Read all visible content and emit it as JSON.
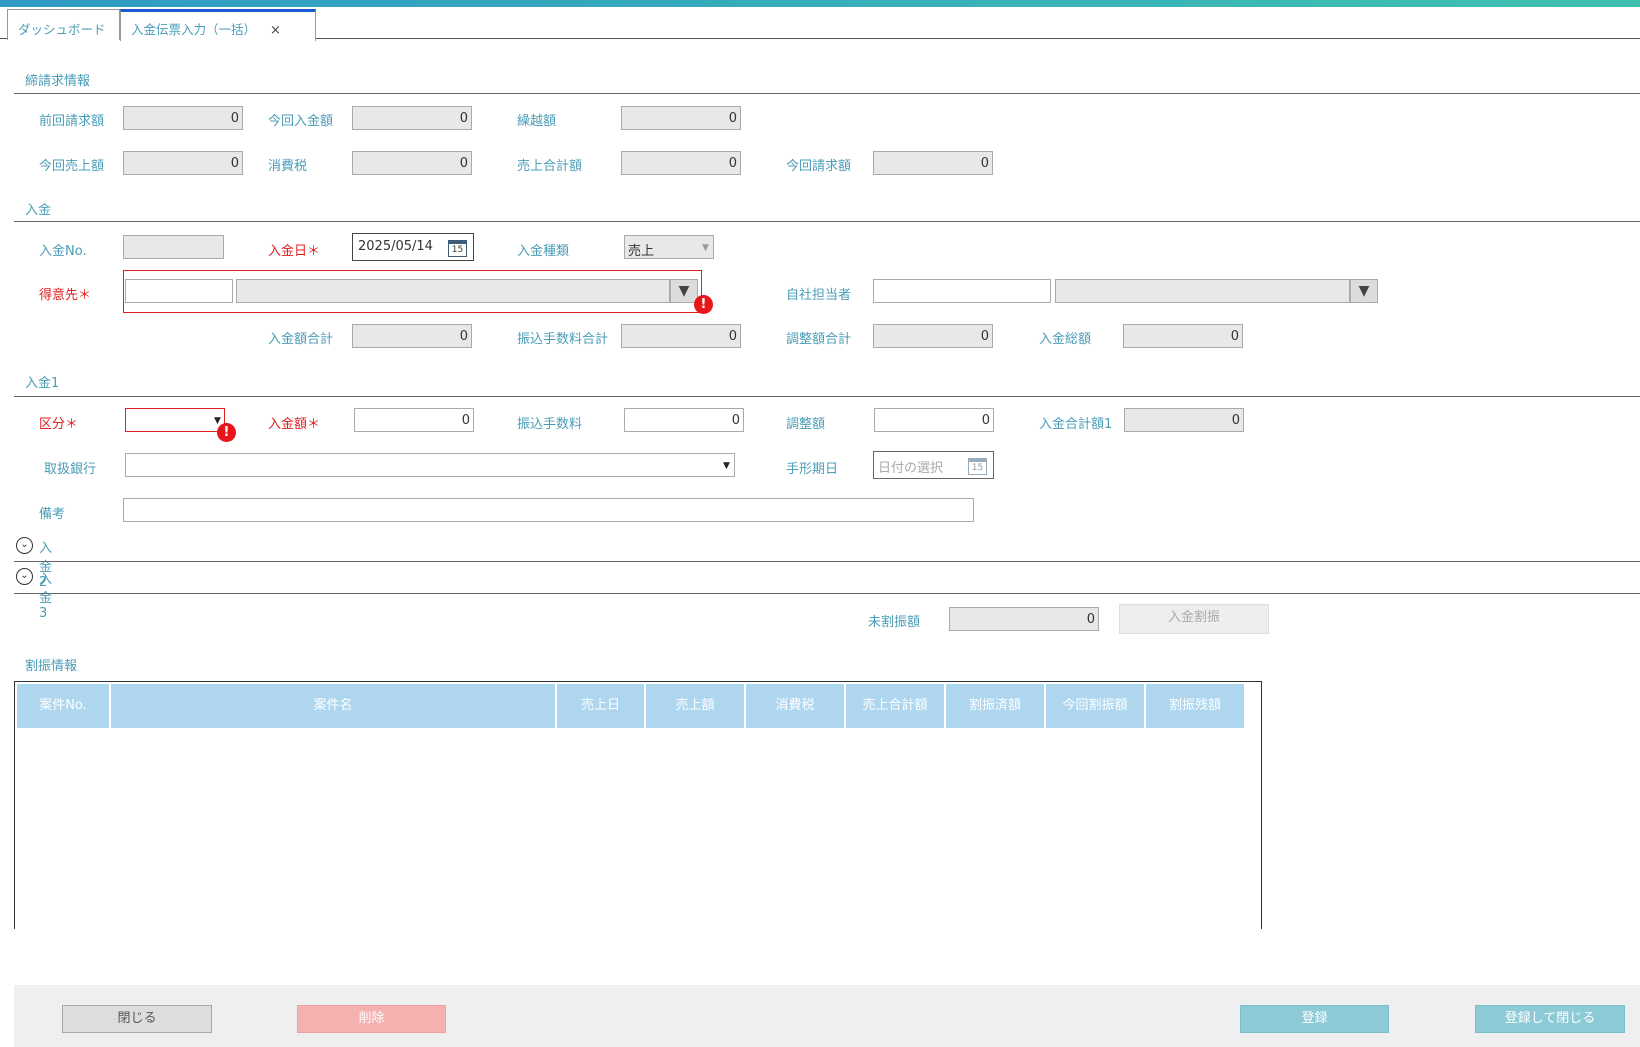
{
  "tabs": {
    "dashboard": "ダッシュボード",
    "active": "入金伝票入力（一括）",
    "close": "×"
  },
  "billing": {
    "title": "締請求情報",
    "prev_billing_label": "前回請求額",
    "prev_billing": "0",
    "this_payment_label": "今回入金額",
    "this_payment": "0",
    "carryover_label": "繰越額",
    "carryover": "0",
    "this_sales_label": "今回売上額",
    "this_sales": "0",
    "tax_label": "消費税",
    "tax": "0",
    "sales_total_label": "売上合計額",
    "sales_total": "0",
    "this_billing_label": "今回請求額",
    "this_billing": "0"
  },
  "payment": {
    "title": "入金",
    "no_label": "入金No.",
    "no": "",
    "date_label": "入金日＊",
    "date": "2025/05/14",
    "type_label": "入金種類",
    "type": "売上",
    "customer_label": "得意先＊",
    "customer_code": "",
    "customer_name": "",
    "staff_label": "自社担当者",
    "staff_code": "",
    "staff_name": "",
    "amount_total_label": "入金額合計",
    "amount_total": "0",
    "fee_total_label": "振込手数料合計",
    "fee_total": "0",
    "adjust_total_label": "調整額合計",
    "adjust_total": "0",
    "grand_total_label": "入金総額",
    "grand_total": "0"
  },
  "payment1": {
    "title": "入金1",
    "category_label": "区分＊",
    "category": "",
    "amount_label": "入金額＊",
    "amount": "0",
    "fee_label": "振込手数料",
    "fee": "0",
    "adjust_label": "調整額",
    "adjust": "0",
    "subtotal_label": "入金合計額1",
    "subtotal": "0",
    "bank_label": "取扱銀行",
    "bank": "",
    "bill_date_label": "手形期日",
    "bill_date_placeholder": "日付の選択",
    "note_label": "備考",
    "note": ""
  },
  "payment2": {
    "title": "入金2"
  },
  "payment3": {
    "title": "入金3"
  },
  "allocation": {
    "unallocated_label": "未割振額",
    "unallocated": "0",
    "allocate_button": "入金割振",
    "title": "割振情報",
    "columns": [
      "案件No.",
      "案件名",
      "売上日",
      "売上額",
      "消費税",
      "売上合計額",
      "割振済額",
      "今回割振額",
      "割振残額"
    ]
  },
  "icons": {
    "calendar_day": "15",
    "chevron": "⌄",
    "dropdown": "▼",
    "caret": "▼",
    "error": "!"
  },
  "footer": {
    "close": "閉じる",
    "delete": "削除",
    "register": "登録",
    "register_close": "登録して閉じる"
  },
  "colors": {
    "label": "#4a9db8",
    "required": "#e02020",
    "header": "#aed6ee",
    "button": "#8ccad6",
    "delete": "#f5b0b0"
  }
}
